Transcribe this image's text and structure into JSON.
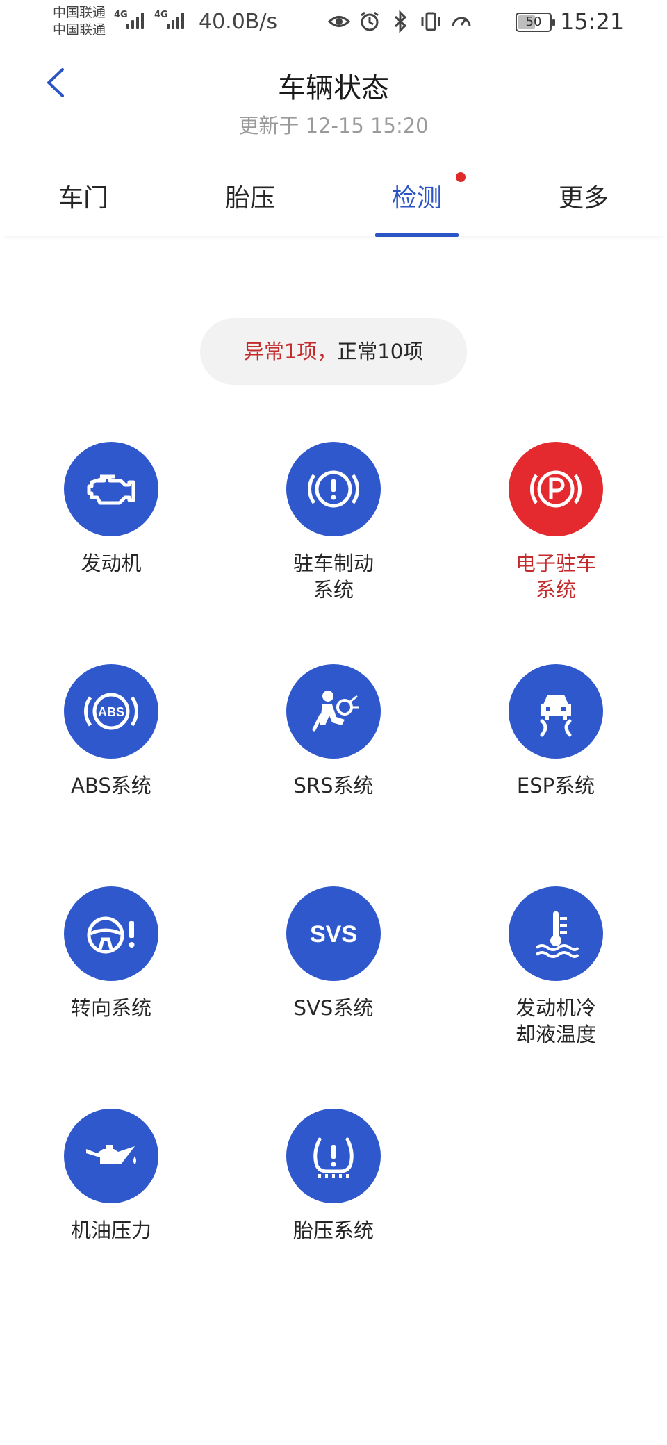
{
  "status_bar": {
    "carrier_1": "中国联通",
    "carrier_2": "中国联通",
    "net_1": "4G",
    "net_2": "4G",
    "speed": "40.0B/s",
    "battery": "50",
    "time": "15:21",
    "icons": [
      "eye-icon",
      "alarm-icon",
      "bluetooth-icon",
      "vibrate-icon",
      "speedometer-icon"
    ]
  },
  "header": {
    "title": "车辆状态",
    "subtitle": "更新于 12-15 15:20"
  },
  "tabs": [
    {
      "label": "车门",
      "active": false
    },
    {
      "label": "胎压",
      "active": false
    },
    {
      "label": "检测",
      "active": true,
      "badge": "red-dot"
    },
    {
      "label": "更多",
      "active": false
    }
  ],
  "summary": {
    "abnormal": "异常1项，",
    "normal": "正常10项"
  },
  "colors": {
    "accent": "#2b55c4",
    "icon_ok": "#2f58cc",
    "icon_error": "#e42a2f",
    "error_text": "#c52a2a"
  },
  "items": [
    {
      "label": "发动机",
      "icon": "engine-icon",
      "status": "normal"
    },
    {
      "label": "驻车制动\n系统",
      "icon": "brake-warning-icon",
      "status": "normal"
    },
    {
      "label": "电子驻车\n系统",
      "icon": "parking-brake-icon",
      "status": "abnormal"
    },
    {
      "label": "ABS系统",
      "icon": "abs-icon",
      "status": "normal"
    },
    {
      "label": "SRS系统",
      "icon": "airbag-icon",
      "status": "normal"
    },
    {
      "label": "ESP系统",
      "icon": "esp-icon",
      "status": "normal"
    },
    {
      "label": "转向系统",
      "icon": "steering-warning-icon",
      "status": "normal"
    },
    {
      "label": "SVS系统",
      "icon": "svs-icon",
      "status": "normal",
      "icon_text": "SVS"
    },
    {
      "label": "发动机冷\n却液温度",
      "icon": "coolant-temperature-icon",
      "status": "normal"
    },
    {
      "label": "机油压力",
      "icon": "oil-pressure-icon",
      "status": "normal"
    },
    {
      "label": "胎压系统",
      "icon": "tire-pressure-icon",
      "status": "normal"
    }
  ]
}
